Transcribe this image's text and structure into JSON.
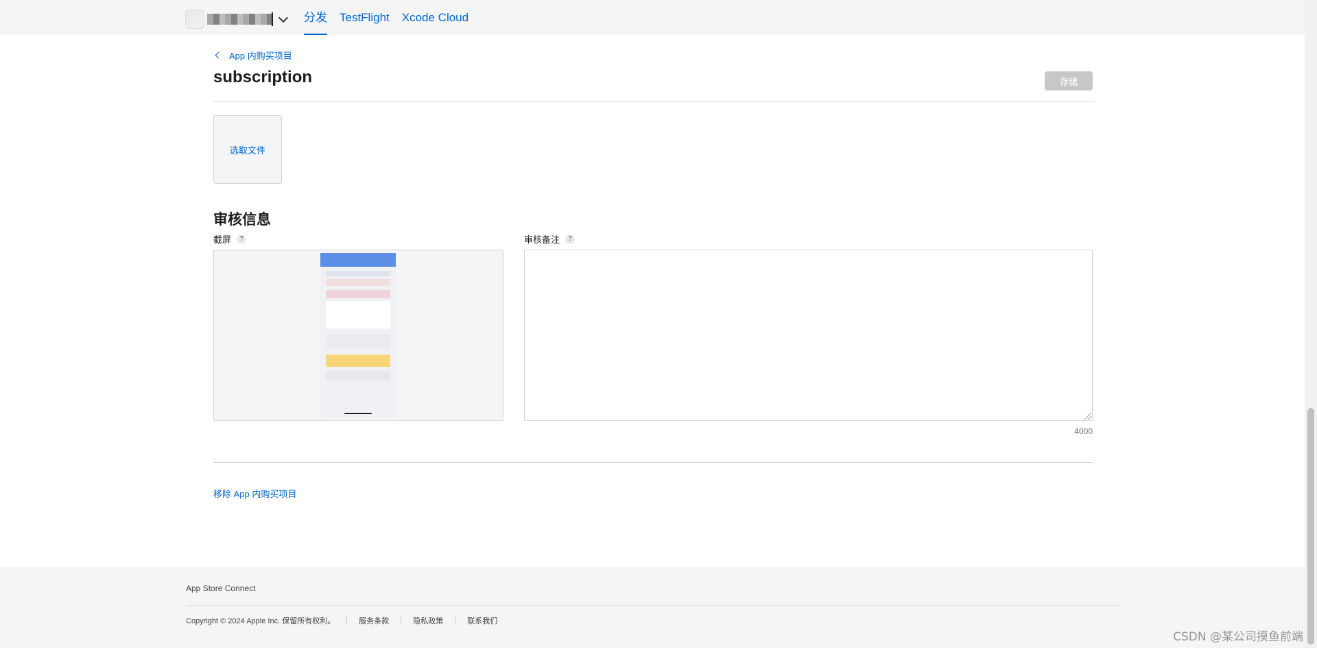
{
  "nav": {
    "tabs": [
      {
        "label": "分发",
        "active": true
      },
      {
        "label": "TestFlight",
        "active": false
      },
      {
        "label": "Xcode Cloud",
        "active": false
      }
    ]
  },
  "breadcrumb": {
    "label": "App 内购买项目"
  },
  "page": {
    "title": "subscription",
    "save_label": "存储"
  },
  "upload": {
    "choose_file_label": "选取文件"
  },
  "review": {
    "section_title": "审核信息",
    "screenshot_label": "截屏",
    "notes_label": "审核备注",
    "help_glyph": "?",
    "notes_value": "",
    "char_count": "4000"
  },
  "actions": {
    "remove_label": "移除 App 内购买项目"
  },
  "footer": {
    "brand": "App Store Connect",
    "copyright": "Copyright © 2024 Apple Inc. 保留所有权利。",
    "links": [
      "服务条款",
      "隐私政策",
      "联系我们"
    ]
  },
  "watermark": "CSDN @某公司摸鱼前端",
  "colors": {
    "link": "#0066cc",
    "nav_bg": "#f5f5f7",
    "button_disabled": "#c7c7c7"
  },
  "icons": [
    "chevron-down-icon",
    "chevron-left-icon",
    "help-icon",
    "resize-grip-icon"
  ]
}
